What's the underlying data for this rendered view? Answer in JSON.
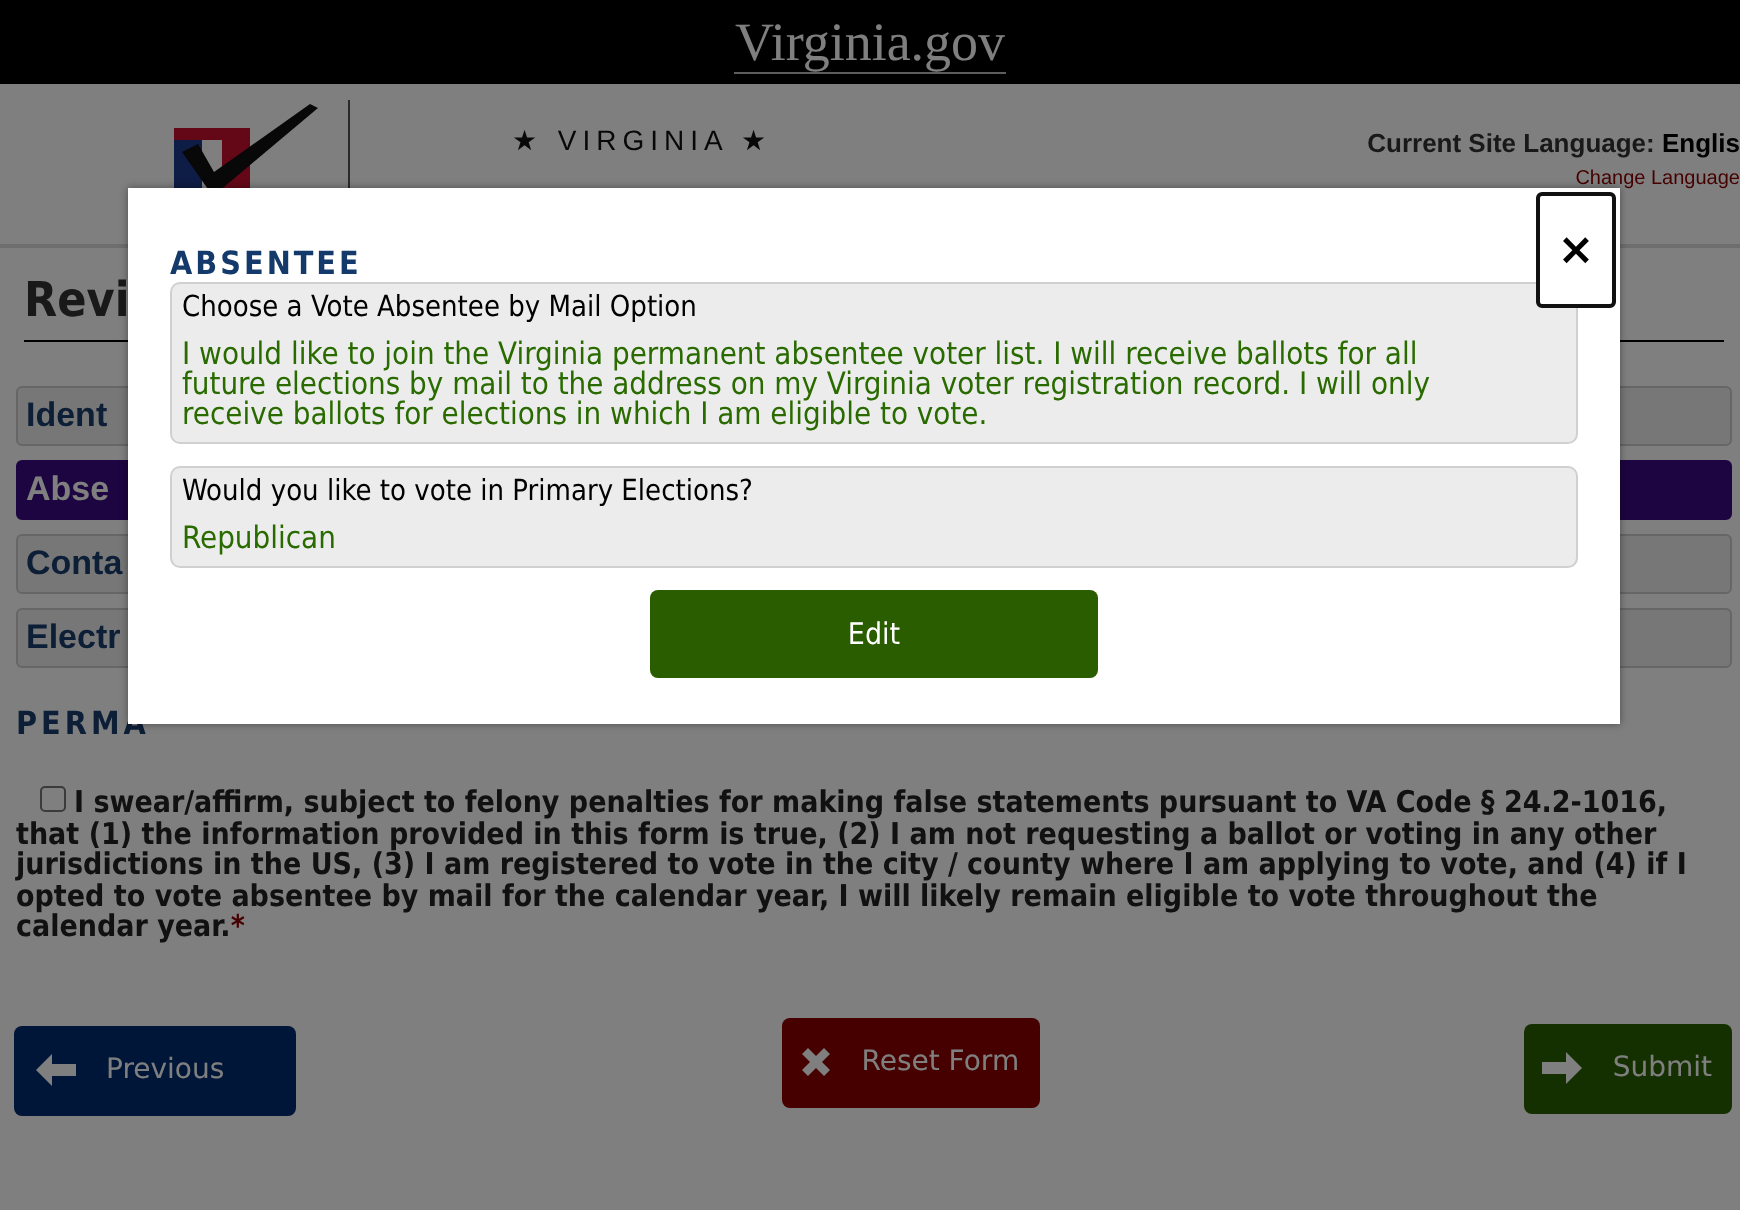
{
  "site_bar": {
    "brand": "Virginia.gov"
  },
  "header": {
    "agency_line1": "★ VIRGINIA ★",
    "language_label": "Current Site Language:",
    "language_value": "Englis",
    "change_language": "Change Language"
  },
  "page": {
    "title": "Revi",
    "sections": [
      {
        "label": "Ident",
        "selected": false
      },
      {
        "label": "Abse",
        "selected": true
      },
      {
        "label": "Conta",
        "selected": false
      },
      {
        "label": "Electr",
        "selected": false
      }
    ],
    "subheading": "PERMA",
    "affirmation": {
      "checked": false,
      "text": "I swear/affirm, subject to felony penalties for making false statements pursuant to VA Code § 24.2-1016, that (1) the information provided in this form is true, (2) I am not requesting a ballot or voting in any other jurisdictions in the US, (3) I am registered to vote in the city / county where I am applying to vote, and (4) if I opted to vote absentee by mail for the calendar year, I will likely remain eligible to vote throughout the calendar year.",
      "required_mark": "*"
    }
  },
  "buttons": [
    {
      "kind": "previous",
      "label": "Previous"
    },
    {
      "kind": "reset",
      "label": "Reset Form"
    },
    {
      "kind": "submit",
      "label": "Submit"
    }
  ],
  "modal": {
    "heading": "ABSENTEE",
    "close": "×",
    "answers": [
      {
        "question": "Choose a Vote Absentee by Mail Option",
        "answer": "I would like to join the Virginia permanent absentee voter list. I will receive ballots for all future elections by mail to the address on my Virginia voter registration record. I will only receive ballots for elections in which I am eligible to vote."
      },
      {
        "question": "Would you like to vote in Primary Elections?",
        "answer": "Republican"
      }
    ],
    "edit_button": "Edit"
  }
}
